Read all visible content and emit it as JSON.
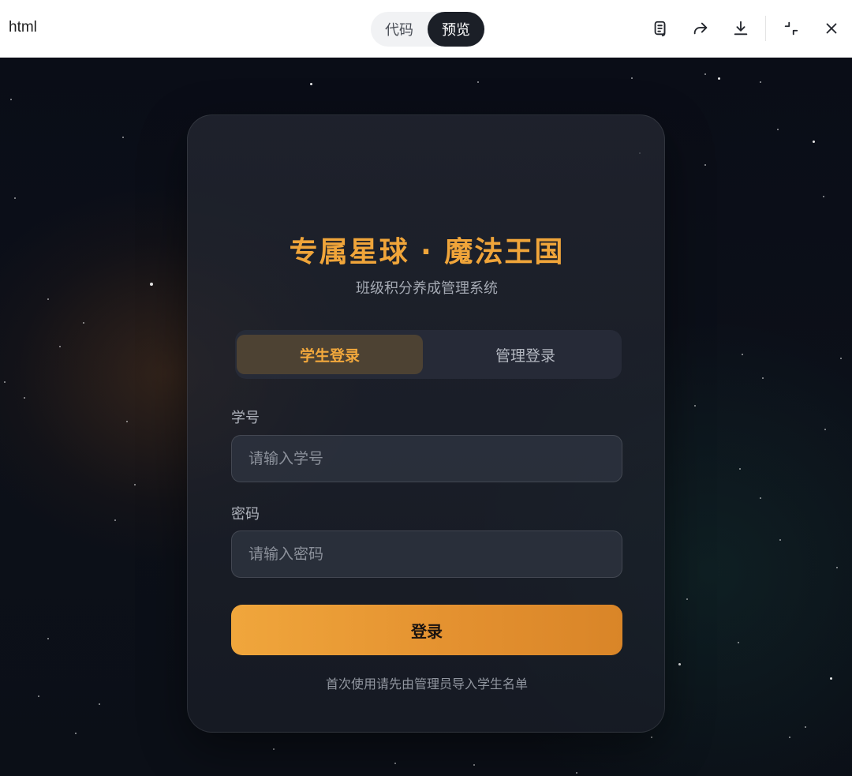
{
  "window": {
    "title": "html",
    "toggle": {
      "code_label": "代码",
      "preview_label": "预览",
      "active": "preview"
    },
    "tools": [
      "copy-icon",
      "share-icon",
      "download-icon",
      "collapse-icon",
      "close-icon"
    ]
  },
  "login": {
    "title": "专属星球 · 魔法王国",
    "subtitle": "班级积分养成管理系统",
    "tabs": [
      {
        "label": "学生登录",
        "active": true
      },
      {
        "label": "管理登录",
        "active": false
      }
    ],
    "student_id": {
      "label": "学号",
      "placeholder": "请输入学号",
      "value": ""
    },
    "password": {
      "label": "密码",
      "placeholder": "请输入密码",
      "value": ""
    },
    "submit_label": "登录",
    "hint": "首次使用请先由管理员导入学生名单"
  },
  "colors": {
    "accent": "#f0a63c",
    "background": "#0b0f17",
    "card": "#232833",
    "toggle_active": "#1b1f27"
  }
}
